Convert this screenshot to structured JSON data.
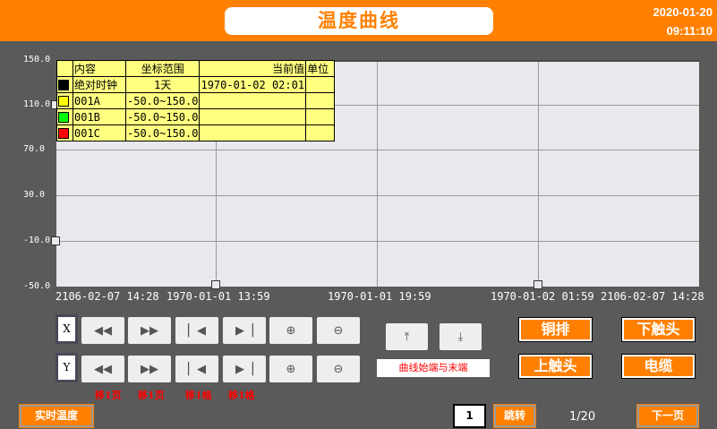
{
  "header": {
    "title": "温度曲线",
    "date": "2020-01-20",
    "time": "09:11:10"
  },
  "chart": {
    "y_ticks": [
      "150.0",
      "110.0",
      "70.0",
      "30.0",
      "-10.0",
      "-50.0"
    ],
    "x_ticks": [
      "2106-02-07 14:28",
      "1970-01-01 13:59",
      "1970-01-01 19:59",
      "1970-01-02 01:59",
      "2106-02-07 14:28"
    ]
  },
  "legend": {
    "headers": [
      "内容",
      "坐标范围",
      "当前值",
      "单位"
    ],
    "rows": [
      {
        "color": "#000000",
        "name": "绝对时钟",
        "range": "1天",
        "value": "1970-01-02 02:01",
        "unit": ""
      },
      {
        "color": "#ffff00",
        "name": "001A",
        "range": "-50.0~150.0",
        "value": "",
        "unit": ""
      },
      {
        "color": "#00ff00",
        "name": "001B",
        "range": "-50.0~150.0",
        "value": "",
        "unit": ""
      },
      {
        "color": "#ff0000",
        "name": "001C",
        "range": "-50.0~150.0",
        "value": "",
        "unit": ""
      }
    ]
  },
  "controls": {
    "x_label": "X",
    "y_label": "Y",
    "hints": [
      "移1页",
      "移1页",
      "移1格",
      "移1格"
    ],
    "ends_label": "曲线始端与末端"
  },
  "buttons": {
    "copper": "铜排",
    "lower": "下触头",
    "upper": "上触头",
    "cable": "电缆",
    "realtime": "实时温度",
    "jump": "跳转",
    "next": "下一页"
  },
  "pager": {
    "input": "1",
    "page": "1/20"
  }
}
